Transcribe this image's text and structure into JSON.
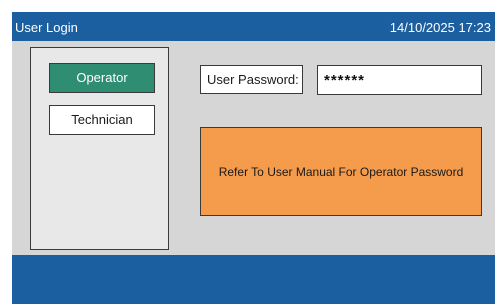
{
  "header": {
    "title": "User Login",
    "datetime": "14/10/2025 17:23"
  },
  "users": {
    "operator_label": "Operator",
    "technician_label": "Technician",
    "selected": "Operator"
  },
  "password": {
    "label": "User Password:",
    "value": "******"
  },
  "message": "Refer To User Manual For Operator Password",
  "colors": {
    "header_bar": "#1c5fa0",
    "footer_bar": "#1c5fa0",
    "background": "#d6d6d6",
    "selected_button": "#2f8e72",
    "message_box": "#f59c4c"
  }
}
